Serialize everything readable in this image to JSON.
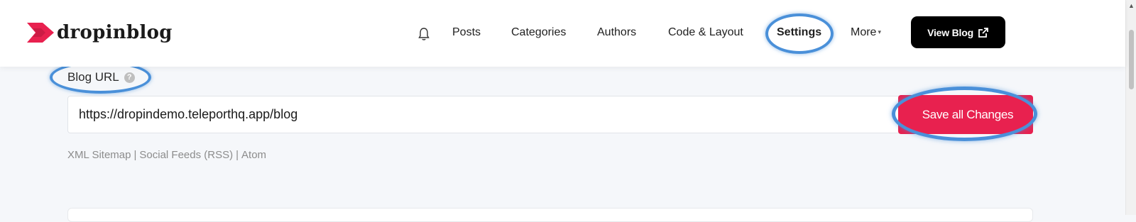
{
  "brand": {
    "name": "dropinblog",
    "accent": "#e8214f"
  },
  "nav": {
    "bell_icon": "bell-icon",
    "items": [
      "Posts",
      "Categories",
      "Authors",
      "Code & Layout",
      "Settings",
      "More"
    ],
    "view_blog_label": "View Blog",
    "view_blog_icon": "external-link-icon"
  },
  "form": {
    "blog_url_label": "Blog URL",
    "help_icon": "?",
    "blog_url_value": "https://dropindemo.teleporthq.app/blog",
    "save_label": "Save all Changes"
  },
  "links": [
    "XML Sitemap",
    "Social Feeds (RSS)",
    "Atom"
  ],
  "highlight_color": "#4a90d9"
}
